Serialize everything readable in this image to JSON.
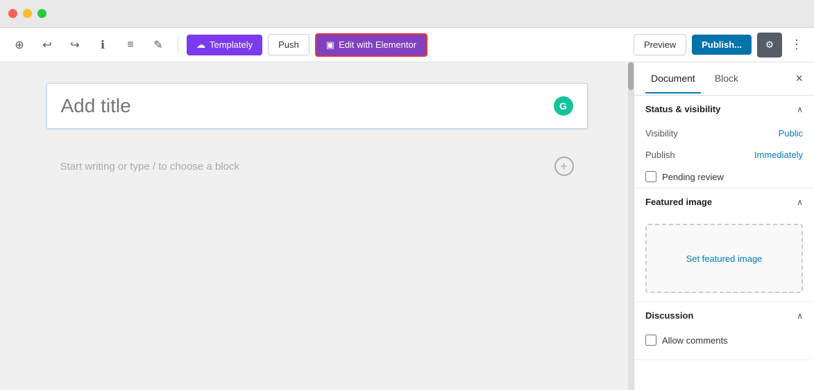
{
  "titlebar": {
    "traffic_lights": [
      "red",
      "yellow",
      "green"
    ]
  },
  "toolbar": {
    "add_label": "+",
    "undo_label": "↩",
    "redo_label": "↪",
    "info_label": "ℹ",
    "list_label": "≡",
    "edit_label": "✎",
    "templately_label": "Templately",
    "push_label": "Push",
    "elementor_label": "Edit with Elementor",
    "preview_label": "Preview",
    "publish_label": "Publish...",
    "settings_label": "⚙",
    "more_label": "⋮"
  },
  "editor": {
    "title_placeholder": "Add title",
    "body_placeholder": "Start writing or type / to choose a block",
    "grammarly_letter": "G"
  },
  "sidebar": {
    "tabs": [
      {
        "id": "document",
        "label": "Document",
        "active": true
      },
      {
        "id": "block",
        "label": "Block",
        "active": false
      }
    ],
    "close_label": "×",
    "sections": {
      "status_visibility": {
        "title": "Status & visibility",
        "visibility_label": "Visibility",
        "visibility_value": "Public",
        "publish_label": "Publish",
        "publish_value": "Immediately",
        "pending_review_label": "Pending review"
      },
      "featured_image": {
        "title": "Featured image",
        "set_label": "Set featured image"
      },
      "discussion": {
        "title": "Discussion",
        "allow_comments_label": "Allow comments"
      }
    }
  }
}
